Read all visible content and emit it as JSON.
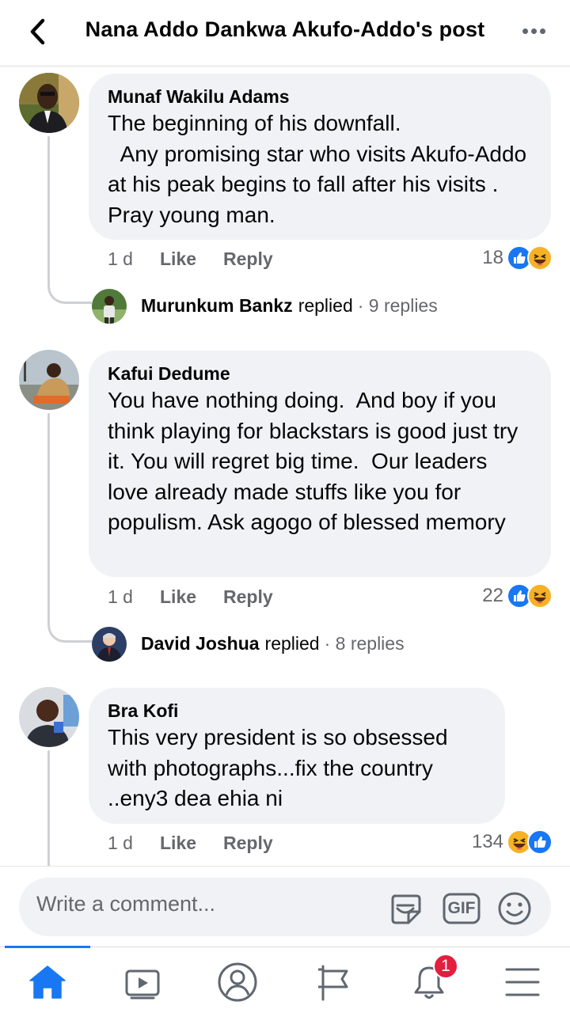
{
  "header": {
    "title": "Nana Addo Dankwa Akufo-Addo's post"
  },
  "comments": [
    {
      "author": "Munaf Wakilu Adams",
      "text": "The beginning of his downfall.\n  Any promising star who visits Akufo-Addo at his peak begins to fall after his visits . Pray young man.",
      "time": "1 d",
      "like_label": "Like",
      "reply_label": "Reply",
      "reaction_count": "18",
      "reactions": [
        "like",
        "haha"
      ],
      "reply_preview": {
        "name": "Murunkum Bankz",
        "verb": "replied",
        "count": "· 9 replies"
      }
    },
    {
      "author": "Kafui Dedume",
      "text": "You have nothing doing.  And boy if you think playing for blackstars is good just try it. You will regret big time.  Our leaders love already made stuffs like you for populism. Ask agogo of blessed memory",
      "time": "1 d",
      "like_label": "Like",
      "reply_label": "Reply",
      "reaction_count": "22",
      "reactions": [
        "like",
        "haha"
      ],
      "reply_preview": {
        "name": "David Joshua",
        "verb": "replied",
        "count": "· 8 replies"
      }
    },
    {
      "author": "Bra Kofi",
      "text": "This very president is so obsessed with photographs...fix the country ..eny3 dea ehia ni",
      "time": "1 d",
      "like_label": "Like",
      "reply_label": "Reply",
      "reaction_count": "134",
      "reactions": [
        "haha",
        "like"
      ]
    }
  ],
  "composer": {
    "placeholder": "Write a comment...",
    "gif_label": "GIF"
  },
  "nav": {
    "items": [
      "home-icon",
      "watch-icon",
      "profile-icon",
      "pages-icon",
      "notifications-icon",
      "menu-icon"
    ],
    "notification_count": "1",
    "active_color": "#1877f2"
  }
}
